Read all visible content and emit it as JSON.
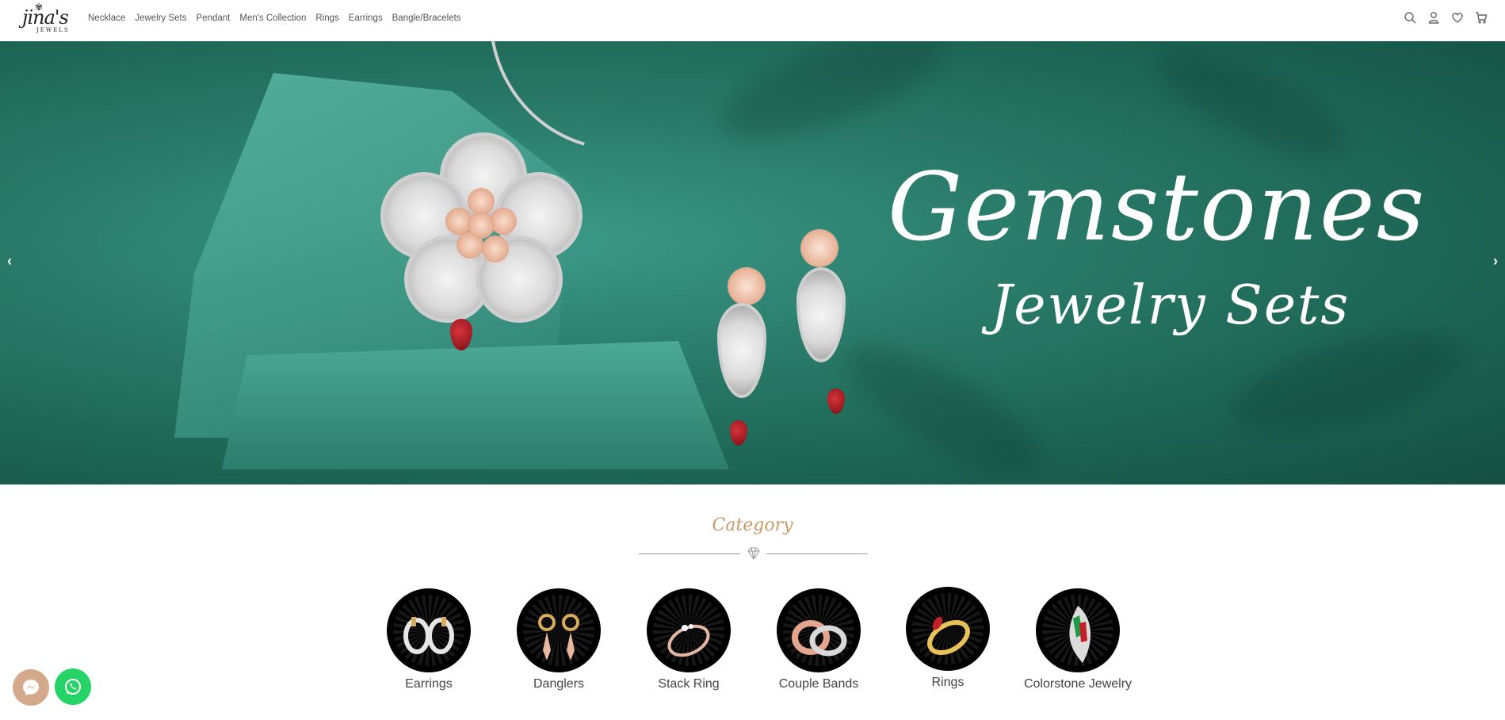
{
  "brand": {
    "name": "jina's",
    "tagline": "JEWELS"
  },
  "nav": [
    "Necklace",
    "Jewelry Sets",
    "Pendant",
    "Men's Collection",
    "Rings",
    "Earrings",
    "Bangle/Bracelets"
  ],
  "header_icons": [
    "search-icon",
    "user-icon",
    "heart-icon",
    "cart-icon"
  ],
  "hero": {
    "title": "Gemstones",
    "subtitle": "Jewelry Sets",
    "prev_arrow": "‹",
    "next_arrow": "›",
    "background_color": "#2a7c6b"
  },
  "category": {
    "heading": "Category",
    "items": [
      "Earrings",
      "Danglers",
      "Stack Ring",
      "Couple Bands",
      "Rings",
      "Colorstone Jewelry"
    ]
  },
  "floating": [
    "messenger-icon",
    "whatsapp-icon"
  ],
  "colors": {
    "accent": "#c99a6a",
    "whatsapp": "#25d366",
    "messenger_bg": "#d4a88a"
  }
}
